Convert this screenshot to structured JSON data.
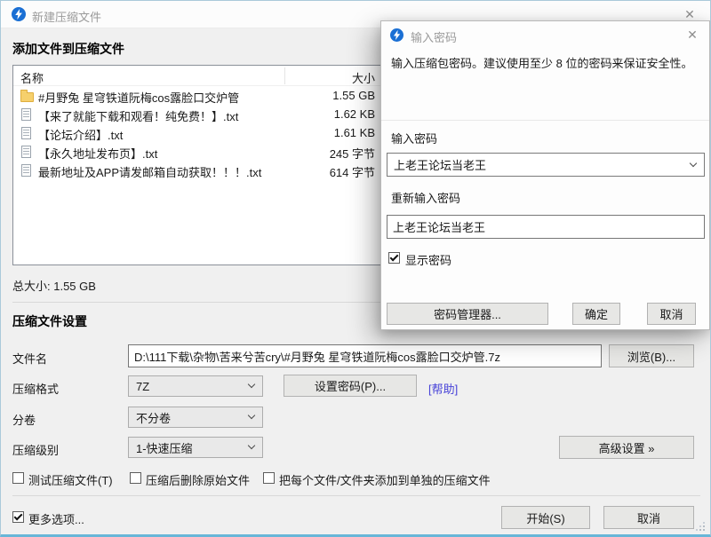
{
  "colors": {
    "accent_icon_blue": "#1a6fd4",
    "help_link": "#4843d8",
    "window_bottom_edge": "#68b6d8"
  },
  "icons": {
    "close": "✕",
    "app_bolt": "lightning-bolt-in-blue-circle"
  },
  "window": {
    "title": "新建压缩文件"
  },
  "add_section": {
    "heading": "添加文件到压缩文件",
    "columns": {
      "name": "名称",
      "size": "大小"
    },
    "files": [
      {
        "icon": "folder",
        "name": "#月野兔 星穹铁道阮梅cos露脸口交炉管",
        "size": "1.55 GB"
      },
      {
        "icon": "text-file",
        "name": "【来了就能下载和观看！纯免费！】.txt",
        "size": "1.62 KB"
      },
      {
        "icon": "text-file",
        "name": "【论坛介绍】.txt",
        "size": "1.61 KB"
      },
      {
        "icon": "text-file",
        "name": "【永久地址发布页】.txt",
        "size": "245 字节"
      },
      {
        "icon": "text-file",
        "name": "最新地址及APP请发邮箱自动获取！！！.txt",
        "size": "614 字节"
      }
    ],
    "total_size": "总大小: 1.55 GB"
  },
  "settings": {
    "heading": "压缩文件设置",
    "filename_label": "文件名",
    "filename_value": "D:\\111下载\\杂物\\苦来兮苦cry\\#月野兔 星穹铁道阮梅cos露脸口交炉管.7z",
    "browse_button": "浏览(B)...",
    "format_label": "压缩格式",
    "format_value": "7Z",
    "set_password_button": "设置密码(P)...",
    "help_link": "[帮助]",
    "volume_label": "分卷",
    "volume_value": "不分卷",
    "level_label": "压缩级别",
    "level_value": "1-快速压缩",
    "advanced_button": "高级设置 »",
    "checkbox_test": {
      "label": "测试压缩文件(T)",
      "checked": false
    },
    "checkbox_delete_original": {
      "label": "压缩后删除原始文件",
      "checked": false
    },
    "checkbox_separate_archives": {
      "label": "把每个文件/文件夹添加到单独的压缩文件",
      "checked": false
    },
    "more_options": {
      "label": "更多选项...",
      "checked": true
    },
    "start_button": "开始(S)",
    "cancel_button": "取消"
  },
  "password_dialog": {
    "title": "输入密码",
    "description": "输入压缩包密码。建议使用至少 8 位的密码来保证安全性。",
    "password_label": "输入密码",
    "password_value": "上老王论坛当老王",
    "confirm_label": "重新输入密码",
    "confirm_value": "上老王论坛当老王",
    "show_password": {
      "label": "显示密码",
      "checked": true
    },
    "manager_button": "密码管理器...",
    "ok_button": "确定",
    "cancel_button": "取消"
  }
}
